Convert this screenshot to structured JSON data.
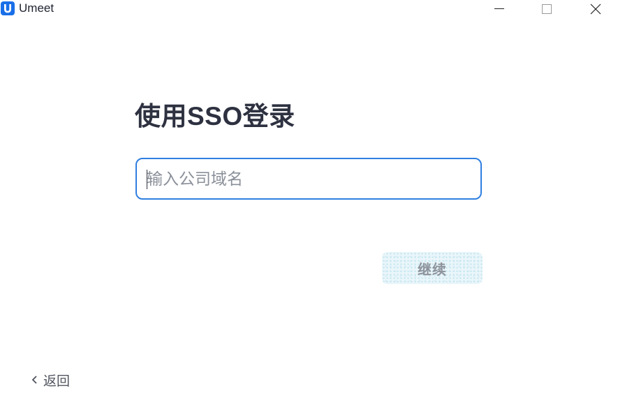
{
  "window": {
    "app_title": "Umeet",
    "logo_icon": "umeet-logo-icon",
    "controls": [
      "minimize-icon",
      "maximize-icon",
      "close-icon"
    ]
  },
  "login": {
    "title": "使用SSO登录",
    "domain_input": {
      "placeholder": "输入公司域名",
      "value": ""
    },
    "continue_label": "继续",
    "back_label": "返回"
  },
  "colors": {
    "accent": "#2f7fe0",
    "logo": "#1a6fe8",
    "title_text": "#2d3140",
    "placeholder": "#8a8f99",
    "button_disabled_bg": "#eaf6fa",
    "button_disabled_text": "#8d939c"
  }
}
